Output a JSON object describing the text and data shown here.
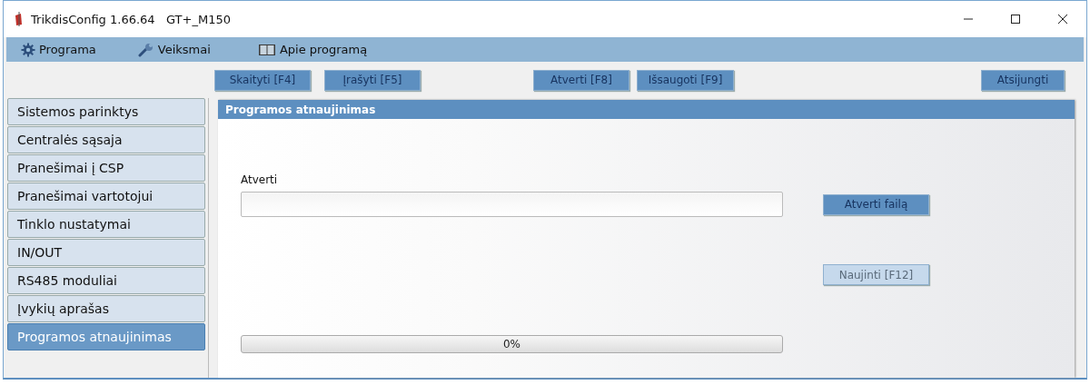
{
  "window": {
    "title": "TrikdisConfig 1.66.64   GT+_M150"
  },
  "menu": [
    {
      "label": "Programa"
    },
    {
      "label": "Veiksmai"
    },
    {
      "label": "Apie programą"
    }
  ],
  "toolbar": [
    {
      "label": "Skaityti [F4]"
    },
    {
      "label": "Įrašyti [F5]"
    },
    {
      "label": "Atverti [F8]"
    },
    {
      "label": "Išsaugoti [F9]"
    },
    {
      "label": "Atsijungti"
    }
  ],
  "sidebar": {
    "items": [
      {
        "label": "Sistemos parinktys",
        "selected": false
      },
      {
        "label": "Centralės sąsaja",
        "selected": false
      },
      {
        "label": "Pranešimai į CSP",
        "selected": false
      },
      {
        "label": "Pranešimai vartotojui",
        "selected": false
      },
      {
        "label": "Tinklo nustatymai",
        "selected": false
      },
      {
        "label": "IN/OUT",
        "selected": false
      },
      {
        "label": "RS485 moduliai",
        "selected": false
      },
      {
        "label": "Įvykių aprašas",
        "selected": false
      },
      {
        "label": "Programos atnaujinimas",
        "selected": true
      }
    ]
  },
  "panel": {
    "title": "Programos atnaujinimas",
    "file_label": "Atverti",
    "open_button": {
      "label": "Atverti failą",
      "disabled": false
    },
    "update_button": {
      "label": "Naujinti [F12]",
      "disabled": true
    },
    "progress": {
      "level": 0,
      "reading": "0%"
    }
  }
}
